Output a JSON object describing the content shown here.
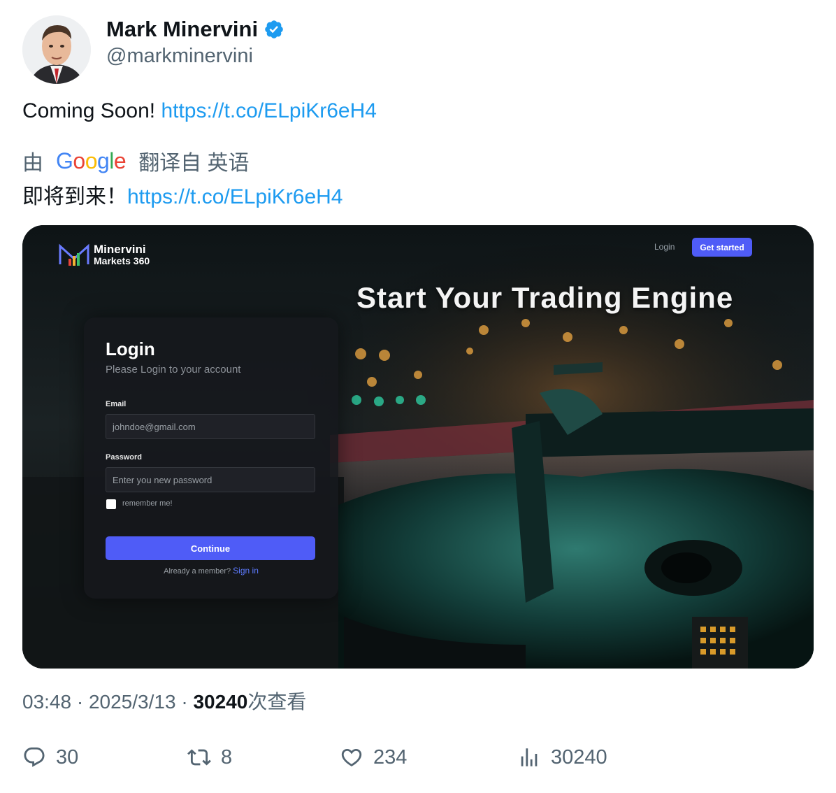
{
  "author": {
    "name": "Mark Minervini",
    "handle": "@markminervini",
    "verified": true
  },
  "tweet": {
    "text": "Coming Soon! ",
    "link": "https://t.co/ELpiKr6eH4"
  },
  "translation": {
    "by_label": "由",
    "provider": "Google",
    "from_label": "翻译自 英语",
    "text": "即将到来！",
    "link": "https://t.co/ELpiKr6eH4"
  },
  "media": {
    "brand_line1": "Minervini",
    "brand_line2": "Markets 360",
    "nav_login": "Login",
    "nav_get_started": "Get started",
    "headline": "Start Your Trading Engine",
    "login_title": "Login",
    "login_subtitle": "Please Login to your account",
    "email_label": "Email",
    "email_placeholder": "johndoe@gmail.com",
    "password_label": "Password",
    "password_placeholder": "Enter you new password",
    "remember_label": "remember me!",
    "continue_label": "Continue",
    "member_prompt": "Already a member? ",
    "sign_in_label": "Sign in"
  },
  "meta": {
    "time": "03:48",
    "separator": " · ",
    "date": "2025/3/13",
    "views_count": "30240",
    "views_label": "次查看"
  },
  "actions": {
    "replies": "30",
    "retweets": "8",
    "likes": "234",
    "views": "30240"
  },
  "colors": {
    "link": "#1d9bf0",
    "verified": "#1d9bf0",
    "secondary_text": "#536471",
    "button_accent": "#4f5cf7"
  }
}
